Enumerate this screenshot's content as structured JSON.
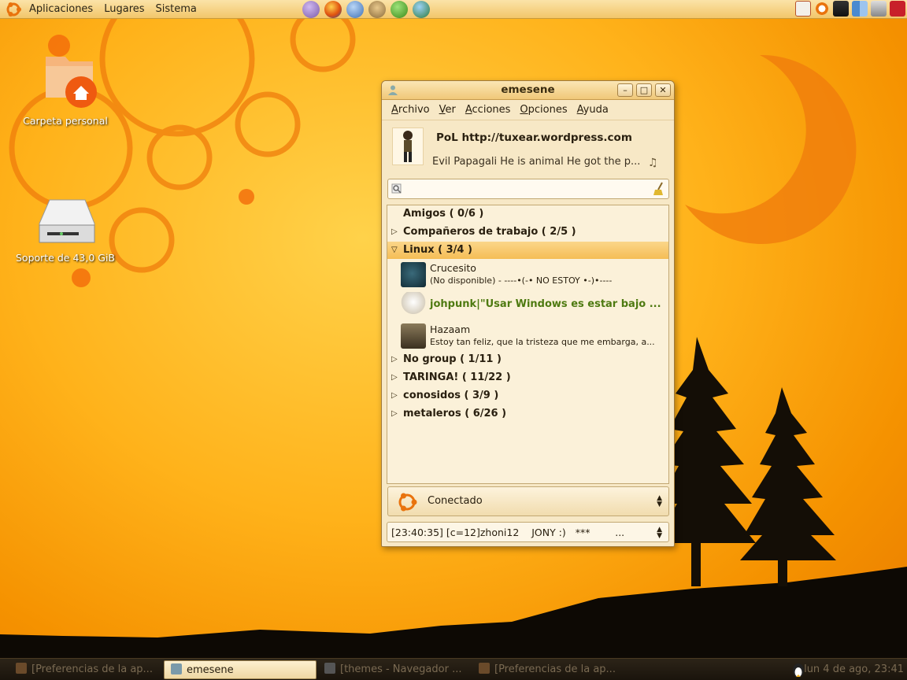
{
  "top_panel": {
    "menus": [
      "Aplicaciones",
      "Lugares",
      "Sistema"
    ],
    "launchers": [
      "pidgin-icon",
      "firefox-icon",
      "thunderbird-icon",
      "rabbit-icon",
      "utorrent-icon",
      "globe-icon"
    ],
    "tray": [
      "update-icon",
      "ubuntu-icon",
      "monitor-icon",
      "network-icon",
      "volume-icon",
      "power-icon"
    ]
  },
  "desktop": {
    "icons": [
      {
        "label": "Carpeta personal",
        "icon": "home-folder-icon"
      },
      {
        "label": "Soporte de 43,0 GiB",
        "icon": "drive-icon"
      }
    ]
  },
  "window": {
    "title": "emesene",
    "menu": [
      "Archivo",
      "Ver",
      "Acciones",
      "Opciones",
      "Ayuda"
    ],
    "profile": {
      "nick": "PoL http://tuxear.wordpress.com",
      "message": "Evil Papagali He is animal He got the p..."
    },
    "search": {
      "placeholder": ""
    },
    "groups": [
      {
        "name": "Amigos ( 0/6 )",
        "expanded": null
      },
      {
        "name": "Compañeros de trabajo ( 2/5 )",
        "expanded": false
      },
      {
        "name": "Linux ( 3/4 )",
        "expanded": true
      },
      {
        "name": "No group ( 1/11 )",
        "expanded": false
      },
      {
        "name": "TARINGA! ( 11/22 )",
        "expanded": false
      },
      {
        "name": "conosidos ( 3/9 )",
        "expanded": false
      },
      {
        "name": "metaleros ( 6/26 )",
        "expanded": false
      }
    ],
    "contacts": [
      {
        "name": "Crucesito",
        "message": "(No disponible) - ----•(-•  NO ESTOY  •-)•----",
        "status": "busy"
      },
      {
        "name": "johpunk|\"Usar Windows es estar bajo ...",
        "message": "",
        "status": "online"
      },
      {
        "name": "Hazaam",
        "message": "Estoy tan feliz, que la tristeza que me embarga, a...",
        "status": "online"
      }
    ],
    "status": "Conectado",
    "personal_message_combo": "[23:40:35] [c=12]zhoni12    JONY :)   ***        ..."
  },
  "taskbar": {
    "tasks": [
      {
        "label": "[Preferencias de la ap...",
        "active": false
      },
      {
        "label": "emesene",
        "active": true
      },
      {
        "label": "[themes - Navegador ...",
        "active": false
      },
      {
        "label": "[Preferencias de la ap...",
        "active": false
      }
    ],
    "clock": "lun  4 de ago, 23:41"
  },
  "colors": {
    "accent": "#f5bd55",
    "online_name": "#4e7a11",
    "panel": "#f2c66a"
  }
}
